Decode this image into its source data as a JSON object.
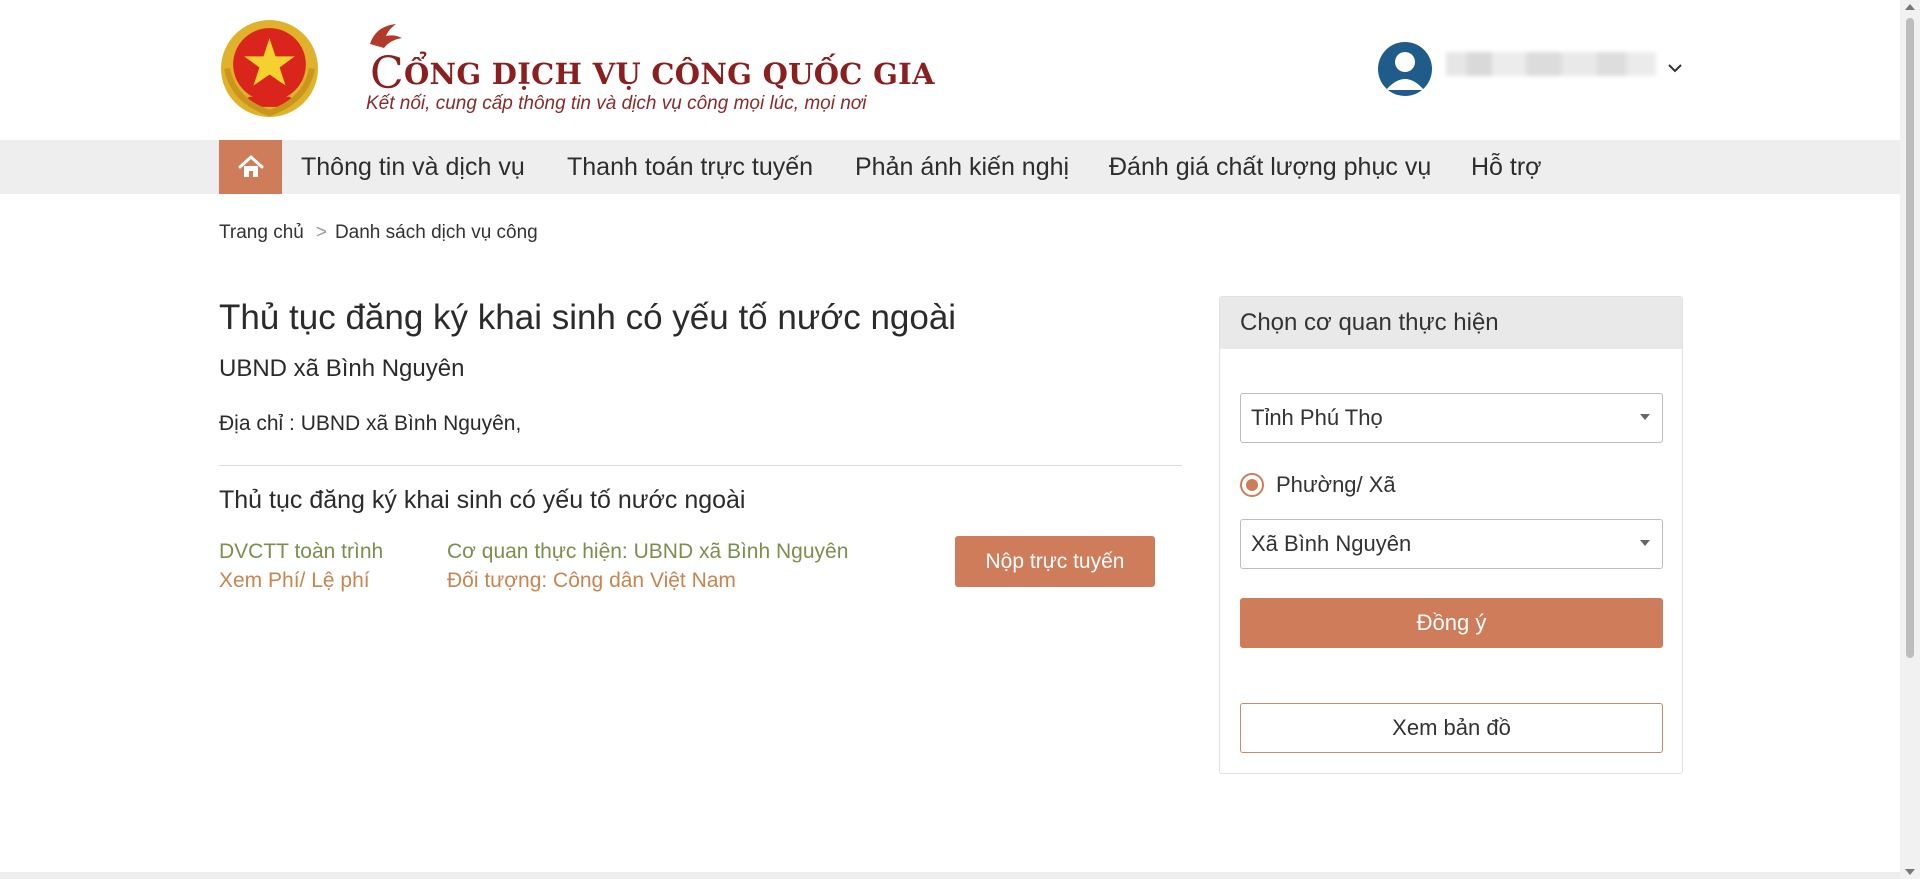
{
  "header": {
    "brand_title_cap": "C",
    "brand_title_rest": "ỔNG DỊCH VỤ CÔNG QUỐC GIA",
    "brand_subtitle": "Kết nối, cung cấp thông tin và dịch vụ công mọi lúc, mọi nơi",
    "user_icon": "user-avatar-icon",
    "user_caret_icon": "chevron-down-icon",
    "brand_color": "#8a1f1f"
  },
  "nav": {
    "home_icon": "home-icon",
    "items": [
      {
        "label": "Thông tin và dịch vụ"
      },
      {
        "label": "Thanh toán trực tuyến"
      },
      {
        "label": "Phản ánh kiến nghị"
      },
      {
        "label": "Đánh giá chất lượng phục vụ"
      },
      {
        "label": "Hỗ trợ"
      }
    ]
  },
  "breadcrumb": {
    "home": "Trang chủ",
    "separator": ">",
    "current": "Danh sách dịch vụ công"
  },
  "main": {
    "title": "Thủ tục đăng ký khai sinh có yếu tố nước ngoài",
    "agency": "UBND xã Bình Nguyên",
    "address": "Địa chỉ : UBND xã Bình Nguyên,",
    "procedure": {
      "title": "Thủ tục đăng ký khai sinh có yếu tố nước ngoài",
      "level": "DVCTT toàn trình",
      "fees_link": "Xem Phí/ Lệ phí",
      "agency_label": "Cơ quan thực hiện: UBND xã Bình Nguyên",
      "audience_label": "Đối tượng: Công dân Việt Nam",
      "submit_label": "Nộp trực tuyến"
    }
  },
  "panel": {
    "title": "Chọn cơ quan thực hiện",
    "province_value": "Tỉnh Phú Thọ",
    "radio_label": "Phường/ Xã",
    "commune_value": "Xã Bình Nguyên",
    "agree_label": "Đồng ý",
    "map_label": "Xem bản đồ"
  },
  "colors": {
    "accent": "#cf7c5a",
    "green_text": "#7d8f4d",
    "orange_text": "#c7854f"
  }
}
